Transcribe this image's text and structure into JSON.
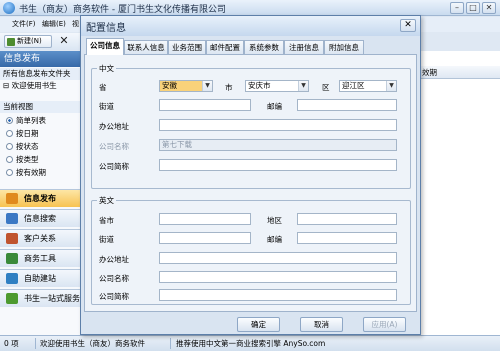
{
  "app": {
    "title": "书生（商友）商务软件 - 厦门书生文化传播有限公司",
    "menu": [
      "文件(F)",
      "编辑(E)",
      "视"
    ],
    "toolbar": {
      "new_label": "新建(N)",
      "close_glyph": "✕"
    }
  },
  "left_panel": {
    "header": "信息发布",
    "breadcrumb": "所有信息发布文件夹",
    "tree_item": "欢迎使用书生",
    "view_label": "当前视图",
    "views": [
      {
        "label": "简单列表",
        "selected": true
      },
      {
        "label": "按日期",
        "selected": false
      },
      {
        "label": "按状态",
        "selected": false
      },
      {
        "label": "按类型",
        "selected": false
      },
      {
        "label": "按有效期",
        "selected": false
      }
    ],
    "nav": [
      {
        "label": "信息发布",
        "icon": "info-publish-icon",
        "color": "#e08a1e",
        "active": true
      },
      {
        "label": "信息搜索",
        "icon": "info-search-icon",
        "color": "#3b78c4",
        "active": false
      },
      {
        "label": "客户关系",
        "icon": "customer-icon",
        "color": "#c0542f",
        "active": false
      },
      {
        "label": "商务工具",
        "icon": "tools-icon",
        "color": "#3a8a3a",
        "active": false
      },
      {
        "label": "自助建站",
        "icon": "website-icon",
        "color": "#2f7fc2",
        "active": false
      },
      {
        "label": "书生一站式服务",
        "icon": "service-icon",
        "color": "#4d9a2f",
        "active": false
      }
    ]
  },
  "right_panel": {
    "column_header": "效期"
  },
  "status_bar": {
    "count": "0 项",
    "message": "欢迎使用书生（商友）商务软件",
    "ad": "推荐使用中文第一商业搜索引擎 AnySo.com"
  },
  "dialog": {
    "title": "配置信息",
    "close": "✕",
    "tabs": [
      "公司信息",
      "联系人信息",
      "业务范围",
      "邮件配置",
      "系统参数",
      "注册信息",
      "附加信息"
    ],
    "active_tab": 0,
    "chinese": {
      "legend": "中文",
      "province_label": "省",
      "province_value": "安徽",
      "city_label": "市",
      "city_value": "安庆市",
      "district_label": "区",
      "district_value": "迎江区",
      "street_label": "街道",
      "street_value": "",
      "postcode_label": "邮编",
      "postcode_value": "",
      "address_label": "办公地址",
      "address_value": "",
      "company_name_label": "公司名称",
      "company_name_value": "第七下载",
      "short_name_label": "公司简称",
      "short_name_value": ""
    },
    "english": {
      "legend": "英文",
      "province_city_label": "省市",
      "region_label": "地区",
      "street_label": "街道",
      "postcode_label": "邮编",
      "address_label": "办公地址",
      "company_name_label": "公司名称",
      "short_name_label": "公司简称"
    },
    "buttons": {
      "ok": "确定",
      "cancel": "取消",
      "apply": "应用(A)"
    }
  },
  "colors": {
    "accent": "#3769a8",
    "active_nav": "#f7c352",
    "highlight": "#f9d27a"
  }
}
